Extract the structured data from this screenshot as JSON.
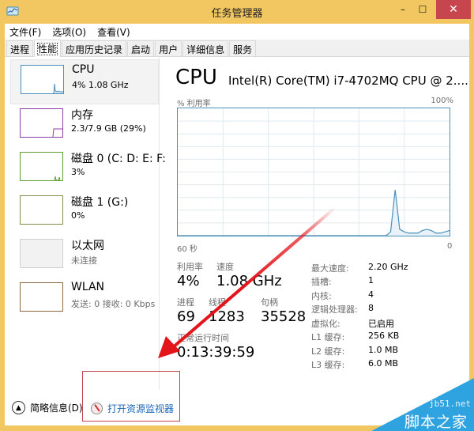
{
  "window": {
    "title": "任务管理器",
    "controls": {
      "minimize": "–",
      "maximize": "☐",
      "close": "✕"
    }
  },
  "menubar": [
    {
      "label": "文件(F)"
    },
    {
      "label": "选项(O)"
    },
    {
      "label": "查看(V)"
    }
  ],
  "tabs": [
    {
      "label": "进程",
      "active": false
    },
    {
      "label": "性能",
      "active": true
    },
    {
      "label": "应用历史记录",
      "active": false
    },
    {
      "label": "启动",
      "active": false
    },
    {
      "label": "用户",
      "active": false
    },
    {
      "label": "详细信息",
      "active": false
    },
    {
      "label": "服务",
      "active": false
    }
  ],
  "sidebar": {
    "items": [
      {
        "name": "CPU",
        "sub": "4% 1.08 GHz",
        "color": "#4a90b8",
        "selected": true
      },
      {
        "name": "内存",
        "sub": "2.3/7.9 GB (29%)",
        "color": "#8b3fa6",
        "selected": false
      },
      {
        "name": "磁盘 0 (C: D: E: F:",
        "sub": "3%",
        "color": "#5e9e2f",
        "selected": false
      },
      {
        "name": "磁盘 1 (G:)",
        "sub": "0%",
        "color": "#8a8a48",
        "selected": false
      },
      {
        "name": "以太网",
        "sub": "未连接",
        "color": "#c8c8c8",
        "selected": false
      },
      {
        "name": "WLAN",
        "sub": "发送: 0 接收: 0 Kbps",
        "color": "#8a6a3a",
        "selected": false
      }
    ]
  },
  "main": {
    "title": "CPU",
    "model": "Intel(R) Core(TM) i7-4702MQ CPU @ 2....",
    "graph": {
      "y_label": "% 利用率",
      "y_max_label": "100%",
      "x_left_label": "60 秒",
      "x_right_label": "0",
      "line_color": "#4a90b8",
      "fill_color": "#e8f2f8",
      "grid_color": "#e0eaf0"
    },
    "stats": {
      "utilization": {
        "label": "利用率",
        "value": "4%"
      },
      "speed": {
        "label": "速度",
        "value": "1.08 GHz"
      },
      "processes": {
        "label": "进程",
        "value": "69"
      },
      "threads": {
        "label": "线程",
        "value": "1283"
      },
      "handles": {
        "label": "句柄",
        "value": "35528"
      },
      "uptime": {
        "label": "正常运行时间",
        "value": "0:13:39:59"
      }
    },
    "info": [
      {
        "label": "最大速度:",
        "value": "2.20 GHz"
      },
      {
        "label": "插槽:",
        "value": "1"
      },
      {
        "label": "内核:",
        "value": "4"
      },
      {
        "label": "逻辑处理器:",
        "value": "8"
      },
      {
        "label": "虚拟化:",
        "value": "已启用"
      },
      {
        "label": "L1 缓存:",
        "value": "256 KB"
      },
      {
        "label": "L2 缓存:",
        "value": "1.0 MB"
      },
      {
        "label": "L3 缓存:",
        "value": "6.0 MB"
      }
    ]
  },
  "footer": {
    "fewer_details": "简略信息(D)",
    "open_resmon": "打开资源监视器"
  },
  "watermark": {
    "site": "jb51.net",
    "name": "脚本之家",
    "color": "#2fa3e0"
  },
  "annotation": {
    "arrow_color": "#e3151b",
    "box_color": "#c2414d"
  },
  "chart_data": {
    "type": "area",
    "title": "% 利用率",
    "xlabel": "",
    "ylabel": "% 利用率",
    "x_range_seconds": [
      60,
      0
    ],
    "ylim": [
      0,
      100
    ],
    "grid": true,
    "x": [
      0,
      5,
      10,
      15,
      20,
      25,
      30,
      35,
      40,
      45,
      46,
      47,
      48,
      49,
      50,
      51,
      52,
      53,
      54,
      55,
      56,
      57,
      58,
      59,
      60
    ],
    "values": [
      0,
      0,
      0,
      0,
      0,
      0,
      0,
      0,
      0,
      0,
      0,
      3,
      36,
      5,
      3,
      2,
      2,
      2,
      4,
      5,
      4,
      2,
      2,
      3,
      4
    ]
  }
}
